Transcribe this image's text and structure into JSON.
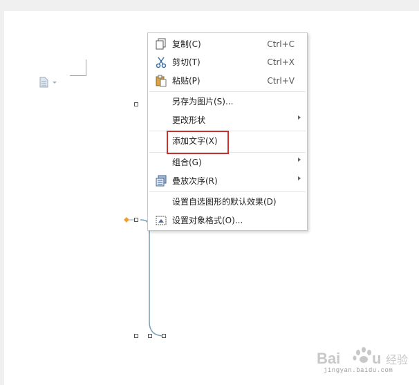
{
  "colors": {
    "connector": "#7da0b6",
    "handle_diamond": "#f0a030",
    "highlight_box": "#c9312f"
  },
  "menu": {
    "items": [
      {
        "label": "复制(C)",
        "shortcut": "Ctrl+C",
        "icon": "copy-icon"
      },
      {
        "label": "剪切(T)",
        "shortcut": "Ctrl+X",
        "icon": "scissors-icon"
      },
      {
        "label": "粘贴(P)",
        "shortcut": "Ctrl+V",
        "icon": "paste-icon"
      },
      {
        "label": "另存为图片(S)...",
        "shortcut": "",
        "icon": ""
      },
      {
        "label": "更改形状",
        "shortcut": "",
        "icon": "",
        "submenu": true
      },
      {
        "label": "添加文字(X)",
        "shortcut": "",
        "icon": "",
        "highlighted": true
      },
      {
        "label": "组合(G)",
        "shortcut": "",
        "icon": "",
        "submenu": true
      },
      {
        "label": "叠放次序(R)",
        "shortcut": "",
        "icon": "layer-order-icon",
        "submenu": true
      },
      {
        "label": "设置自选图形的默认效果(D)",
        "shortcut": "",
        "icon": ""
      },
      {
        "label": "设置对象格式(O)...",
        "shortcut": "",
        "icon": "format-object-icon"
      }
    ]
  },
  "watermark": {
    "text": "Baidu 经验",
    "url": "jingyan.baidu.com"
  }
}
